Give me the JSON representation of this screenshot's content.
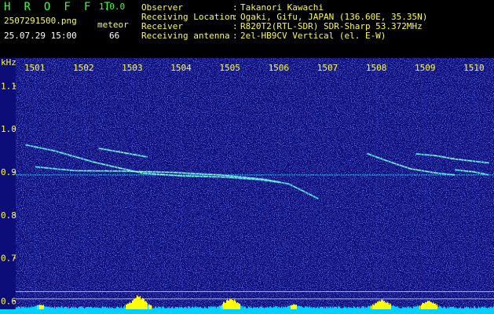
{
  "header": {
    "app_title": "H R O F F T",
    "app_version": "1.0.0",
    "file_name": "2507291500.png",
    "date_time": "25.07.29 15:00",
    "meteor_label": "meteor",
    "meteor_count": "66",
    "info": [
      {
        "label": "Observer",
        "value": "Takanori Kawachi"
      },
      {
        "label": "Receiving Location",
        "value": "Ogaki, Gifu, JAPAN (136.60E, 35.35N)"
      },
      {
        "label": "Receiver",
        "value": "R820T2(RTL-SDR) SDR-Sharp 53.372MHz"
      },
      {
        "label": "Receiving antenna",
        "value": "2el-HB9CV Vertical (el. E-W)"
      }
    ],
    "separator": ":"
  },
  "colors": {
    "background": "#000000",
    "plot_background": "#0c0d78",
    "label_green": "#39ff39",
    "label_yellow": "#ffff33",
    "label_white": "#ffffff",
    "signal_band": "#ffff00",
    "baseline": "#00e5ff"
  },
  "chart_data": {
    "type": "heatmap",
    "y_unit_label": "kHz",
    "x_tick_labels": [
      "1501",
      "1502",
      "1503",
      "1504",
      "1505",
      "1506",
      "1507",
      "1508",
      "1509",
      "1510"
    ],
    "y_tick_labels": [
      "1.1",
      "1.0",
      "0.9",
      "0.8",
      "0.7",
      "0.6"
    ],
    "y_ticks": [
      1.1,
      1.0,
      0.9,
      0.8,
      0.7,
      0.6
    ],
    "x_range": [
      1500.6,
      1510.4
    ],
    "y_range": [
      0.57,
      1.15
    ],
    "carrier_khz": 0.893,
    "reference_lines_khz": [
      0.622,
      0.605
    ],
    "echo_traces": [
      {
        "id": "trace-1",
        "points": [
          [
            1500.8,
            0.963
          ],
          [
            1501.4,
            0.949
          ],
          [
            1502.2,
            0.923
          ],
          [
            1503.2,
            0.897
          ],
          [
            1504.0,
            0.891
          ],
          [
            1504.9,
            0.888
          ],
          [
            1505.6,
            0.882
          ],
          [
            1506.0,
            0.876
          ]
        ]
      },
      {
        "id": "trace-2",
        "points": [
          [
            1501.0,
            0.912
          ],
          [
            1501.8,
            0.903
          ],
          [
            1502.8,
            0.902
          ],
          [
            1503.8,
            0.899
          ],
          [
            1504.8,
            0.893
          ],
          [
            1505.7,
            0.883
          ],
          [
            1506.2,
            0.872
          ],
          [
            1506.8,
            0.838
          ]
        ]
      },
      {
        "id": "trace-3",
        "points": [
          [
            1502.3,
            0.955
          ],
          [
            1502.8,
            0.945
          ],
          [
            1503.3,
            0.935
          ]
        ]
      },
      {
        "id": "trace-4",
        "points": [
          [
            1507.8,
            0.943
          ],
          [
            1508.2,
            0.926
          ],
          [
            1508.7,
            0.907
          ],
          [
            1509.2,
            0.898
          ],
          [
            1509.6,
            0.893
          ]
        ]
      },
      {
        "id": "trace-5",
        "points": [
          [
            1508.8,
            0.942
          ],
          [
            1509.2,
            0.938
          ],
          [
            1509.6,
            0.93
          ],
          [
            1510.3,
            0.921
          ]
        ]
      },
      {
        "id": "trace-6",
        "points": [
          [
            1509.6,
            0.905
          ],
          [
            1510.0,
            0.9
          ],
          [
            1510.3,
            0.893
          ]
        ]
      }
    ],
    "signal_bursts": [
      {
        "x": 1503.1,
        "level": 0.85
      },
      {
        "x": 1505.0,
        "level": 0.7
      },
      {
        "x": 1508.1,
        "level": 0.6
      },
      {
        "x": 1509.05,
        "level": 0.55
      },
      {
        "x": 1501.1,
        "level": 0.3
      },
      {
        "x": 1506.3,
        "level": 0.3
      }
    ]
  }
}
